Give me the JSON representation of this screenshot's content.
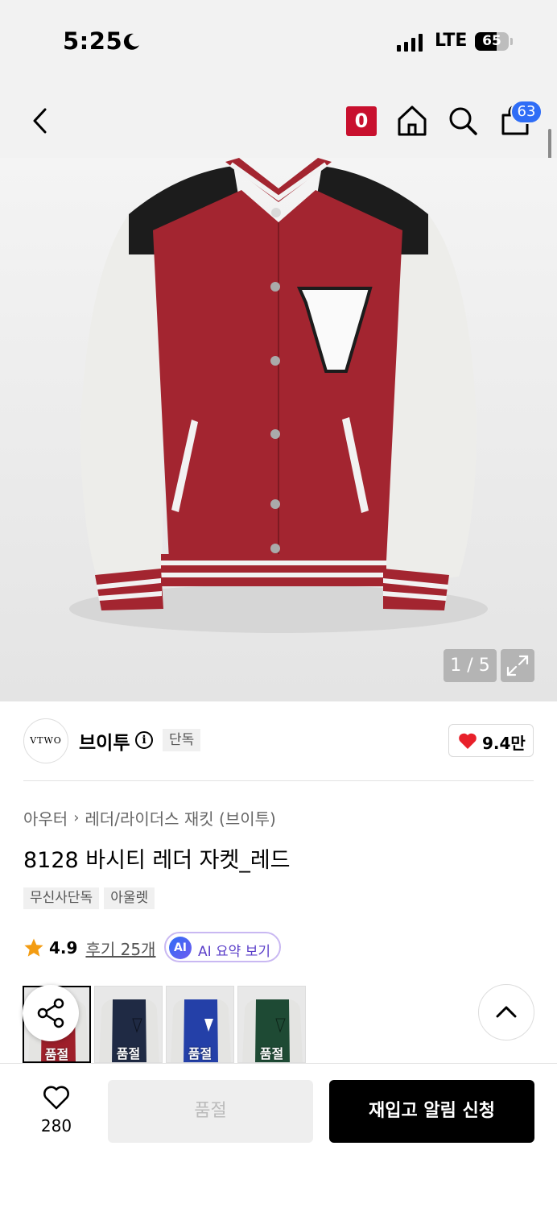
{
  "status_bar": {
    "time": "5:25",
    "network": "LTE",
    "battery": "65"
  },
  "header": {
    "o_badge": "0",
    "cart_count": "63"
  },
  "gallery": {
    "page_indicator": "1 / 5",
    "image_subject": "red-white-varsity-leather-jacket"
  },
  "brand": {
    "logo_text": "VTWO",
    "name": "브이투",
    "exclusive_tag": "단독",
    "likes": "9.4만"
  },
  "breadcrumb": {
    "category": "아우터",
    "subcategory": "레더/라이더스 재킷 (브이투)"
  },
  "product": {
    "title": "8128 바시티 레더 자켓_레드",
    "tags": [
      "무신사단독",
      "아울렛"
    ]
  },
  "rating": {
    "score": "4.9",
    "reviews": "후기 25개",
    "ai_icon": "AI",
    "ai_summary": "AI 요약 보기"
  },
  "variants": [
    {
      "color": "red",
      "sold_label": "품절",
      "body_color": "#9e1f2a",
      "patch_color": "#ffffff"
    },
    {
      "color": "navy",
      "sold_label": "품절",
      "body_color": "#1f2a44",
      "patch_color": "#1f2a44"
    },
    {
      "color": "blue",
      "sold_label": "품절",
      "body_color": "#2440a8",
      "patch_color": "#ffffff"
    },
    {
      "color": "green",
      "sold_label": "품절",
      "body_color": "#1e4a34",
      "patch_color": "#1e4a34"
    }
  ],
  "bottom": {
    "wish_count": "280",
    "soldout_label": "품절",
    "restock_label": "재입고 알림 신청"
  },
  "colors": {
    "brand_red": "#c8102e",
    "cart_badge": "#2f6df6",
    "heart": "#e8202a",
    "star": "#f39c12"
  }
}
